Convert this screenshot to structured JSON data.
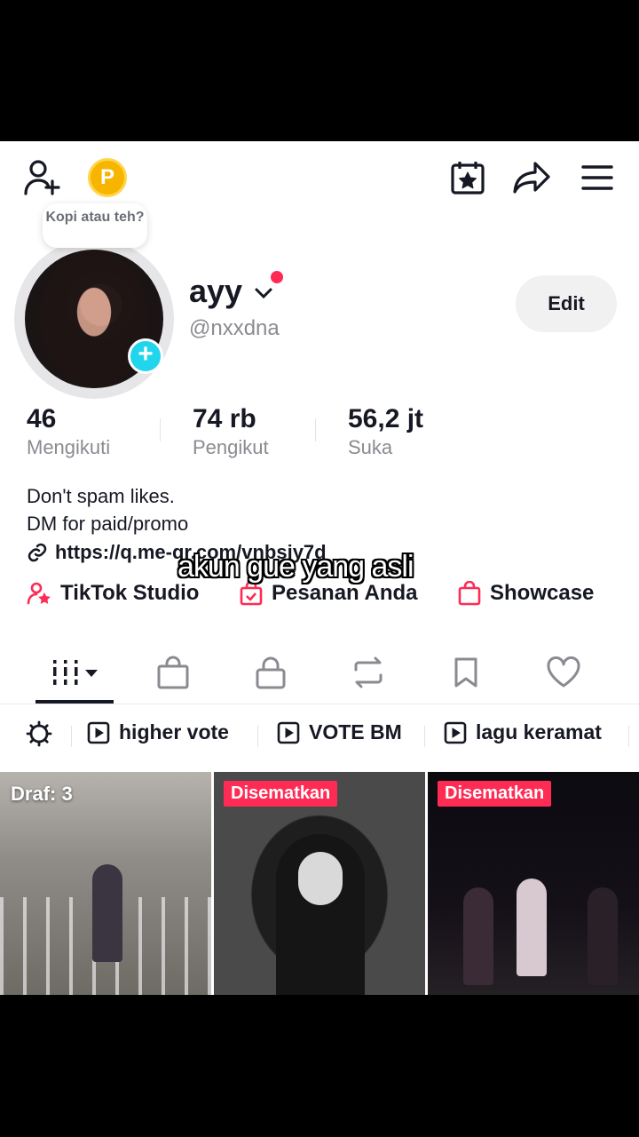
{
  "topbar": {
    "coin_label": "P"
  },
  "profile": {
    "note": "Kopi atau teh?",
    "name": "ayy",
    "handle": "@nxxdna",
    "edit_label": "Edit",
    "stats": [
      {
        "value": "46",
        "label": "Mengikuti"
      },
      {
        "value": "74 rb",
        "label": "Pengikut"
      },
      {
        "value": "56,2 jt",
        "label": "Suka"
      }
    ],
    "bio_line_1": "Don't spam likes.",
    "bio_line_2": "DM for paid/promo",
    "link": "https://q.me-qr.com/vnbsjy7d"
  },
  "chips": {
    "studio": "TikTok Studio",
    "orders": "Pesanan Anda",
    "showcase": "Showcase"
  },
  "caption": "akun gue yang asli",
  "playlists": [
    {
      "label": "higher vote"
    },
    {
      "label": "VOTE BM"
    },
    {
      "label": "lagu keramat"
    }
  ],
  "videos": [
    {
      "badge": "Draf: 3"
    },
    {
      "badge": "Disematkan"
    },
    {
      "badge": "Disematkan"
    }
  ],
  "colors": {
    "accent": "#fe2c55",
    "teal": "#20d5ec",
    "coin": "#f7b500"
  }
}
